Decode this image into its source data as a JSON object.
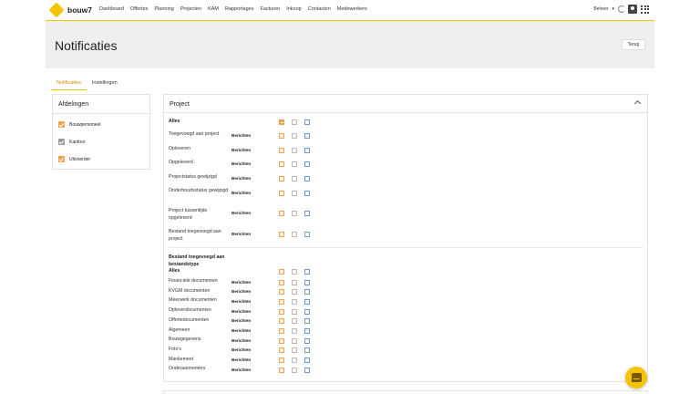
{
  "app": {
    "logo_text": "bouw7",
    "accent_color": "#f5c400"
  },
  "nav": {
    "items": [
      "Dashboard",
      "Offertes",
      "Planning",
      "Projecten",
      "KAM",
      "Rapportages",
      "Facturen",
      "Inkoop",
      "Contacten",
      "Medewerkers"
    ]
  },
  "top_right": {
    "company": "Beheer",
    "icons": [
      "sync-icon",
      "user-icon",
      "apps-grid-icon"
    ]
  },
  "page": {
    "title": "Notificaties",
    "back_button": "Terug"
  },
  "tabs": [
    {
      "label": "Notificaties",
      "active": true
    },
    {
      "label": "Instellingen",
      "active": false
    }
  ],
  "departments": {
    "title": "Afdelingen",
    "items": [
      {
        "label": "Bouwpersoneel",
        "checked": true,
        "color": "#f0a14a"
      },
      {
        "label": "Kantoor",
        "checked": true,
        "color": "#9a9a9a"
      },
      {
        "label": "Uitvoerder",
        "checked": true,
        "color": "#f0a14a"
      }
    ]
  },
  "project_panel": {
    "title": "Project",
    "section1": {
      "all_label": "Alles",
      "rows": [
        {
          "label": "Toegevoegd aan project",
          "type": "Berichten"
        },
        {
          "label": "Opleveren",
          "type": "Berichten"
        },
        {
          "label": "Opgeleverd",
          "type": "Berichten"
        },
        {
          "label": "Projectstatus gewijzigd",
          "type": "Berichten"
        },
        {
          "label": "Onderhoudsstatus gewijzigd",
          "type": "Berichten"
        },
        {
          "label": "Project tussentijds opgeleverd",
          "type": "Berichten"
        },
        {
          "label": "Bestand toegevoegd aan project",
          "type": "Berichten"
        }
      ]
    },
    "section2": {
      "heading": "Bestand toegevoegd aan bestandstype",
      "all_label": "Alles",
      "rows": [
        {
          "label": "Financiele documenten",
          "type": "Berichten"
        },
        {
          "label": "KVGM documenten",
          "type": "Berichten"
        },
        {
          "label": "Meerwerk documenten",
          "type": "Berichten"
        },
        {
          "label": "Opleverdocumenten",
          "type": "Berichten"
        },
        {
          "label": "Offertedocumenten",
          "type": "Berichten"
        },
        {
          "label": "Algemeen",
          "type": "Berichten"
        },
        {
          "label": "Bouwgegevens",
          "type": "Berichten"
        },
        {
          "label": "Foto's",
          "type": "Berichten"
        },
        {
          "label": "Mankement",
          "type": "Berichten"
        },
        {
          "label": "Onderaannemers",
          "type": "Berichten"
        }
      ]
    }
  },
  "chat": {
    "icon": "chat-icon"
  }
}
